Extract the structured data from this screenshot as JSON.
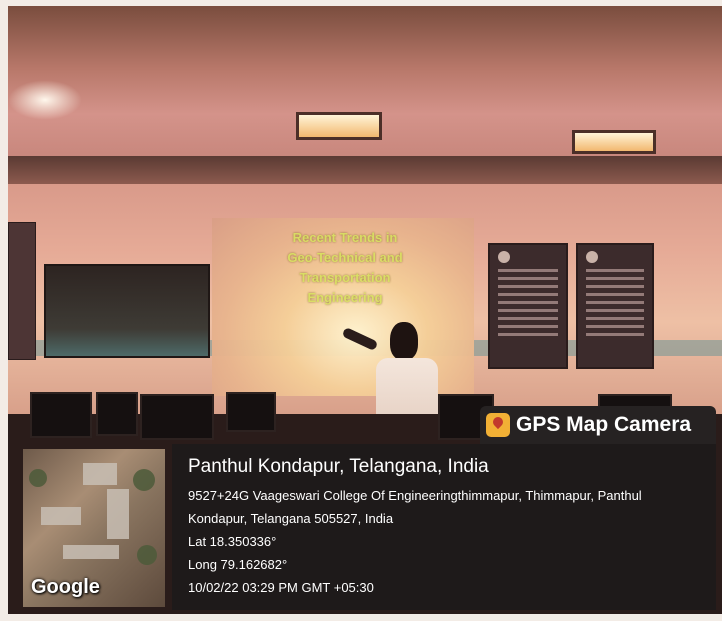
{
  "slide": {
    "title_lines": [
      "Recent Trends in",
      "Geo-Technical and",
      "Transportation",
      "Engineering"
    ]
  },
  "gps_overlay": {
    "app_name": "GPS Map Camera",
    "app_icon": "map-pin-icon",
    "location_title": "Panthul Kondapur, Telangana, India",
    "address_line_1": "9527+24G Vaageswari College Of Engineeringthimmapur, Thimmapur, Panthul",
    "address_line_2": "Kondapur, Telangana 505527, India",
    "latitude": "Lat 18.350336°",
    "longitude": "Long 79.162682°",
    "timestamp": "10/02/22 03:29 PM GMT +05:30",
    "map_logo": "Google"
  },
  "colors": {
    "overlay_bg": "#1e1a1a",
    "badge_bg": "#262222",
    "icon_accent": "#f2b035",
    "slide_text": "#d8e060"
  }
}
